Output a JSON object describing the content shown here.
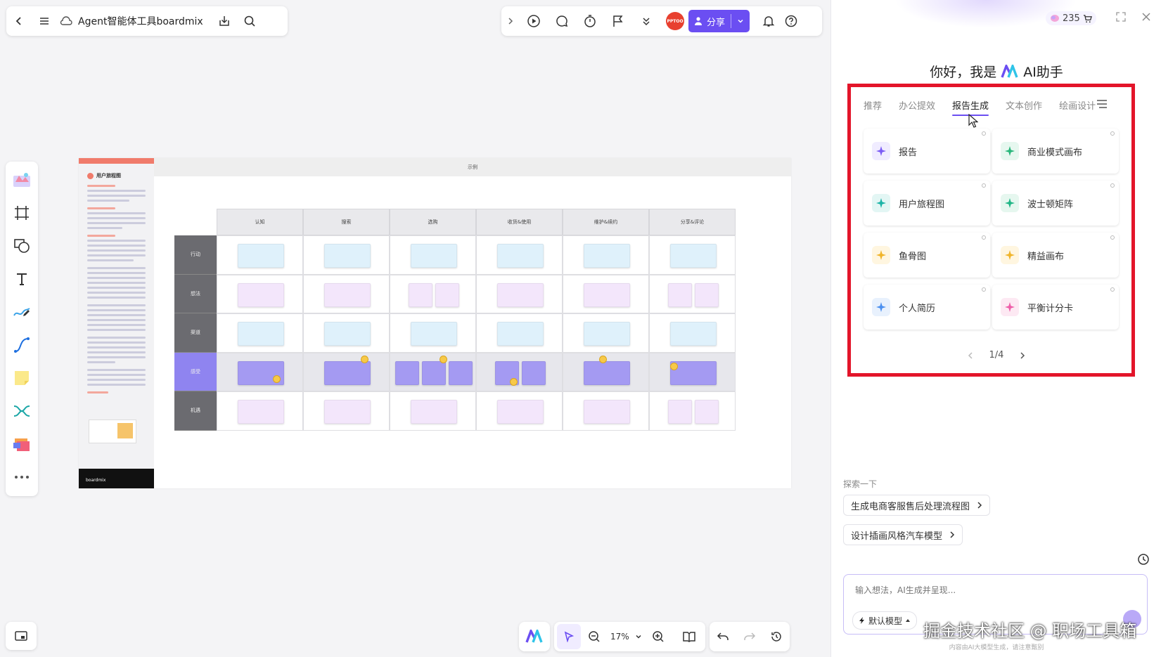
{
  "topbar": {
    "doc_title": "Agent智能体工具boardmix"
  },
  "toolbar": {
    "avatar_text": "PPTOO",
    "share_label": "分享"
  },
  "board": {
    "header_title": "示例",
    "side_title": "用户旅程图",
    "side_footer": "boardmix",
    "columns": [
      "认知",
      "搜索",
      "选购",
      "收货&使用",
      "维护&续约",
      "分享&评论"
    ],
    "rows": [
      "行动",
      "想法",
      "渠道",
      "感受",
      "机遇"
    ]
  },
  "zoom": {
    "value": "17%"
  },
  "ai_panel": {
    "credits": "235",
    "greeting_prefix": "你好，我是",
    "greeting_suffix": "AI助手",
    "tabs": [
      {
        "label": "推荐",
        "active": false
      },
      {
        "label": "办公提效",
        "active": false
      },
      {
        "label": "报告生成",
        "active": true
      },
      {
        "label": "文本创作",
        "active": false
      },
      {
        "label": "绘画设计",
        "active": false
      }
    ],
    "cards": [
      {
        "label": "报告",
        "color": "#7a5af5",
        "bg": "#f0ecff"
      },
      {
        "label": "商业模式画布",
        "color": "#27b67a",
        "bg": "#e6f7ef"
      },
      {
        "label": "用户旅程图",
        "color": "#1ab3a6",
        "bg": "#e3f6f4"
      },
      {
        "label": "波士顿矩阵",
        "color": "#1fb585",
        "bg": "#e6f7ef"
      },
      {
        "label": "鱼骨图",
        "color": "#f0b429",
        "bg": "#fff6e0"
      },
      {
        "label": "精益画布",
        "color": "#f0b429",
        "bg": "#fff6e0"
      },
      {
        "label": "个人简历",
        "color": "#4a8ff0",
        "bg": "#e8f1fd"
      },
      {
        "label": "平衡计分卡",
        "color": "#ee5da8",
        "bg": "#fde9f3"
      }
    ],
    "pager": "1/4",
    "explore_label": "探索一下",
    "suggestions": [
      "生成电商客服售后处理流程图",
      "设计插画风格汽车模型"
    ],
    "chat_placeholder": "输入想法，AI生成并呈现...",
    "model_label": "默认模型",
    "footnote": "内容由AI大模型生成，请注意甄别"
  },
  "watermark": "掘金技术社区 @ 职场工具箱",
  "colors": {
    "accent": "#6b4ef2",
    "highlight_box": "#e3152a"
  }
}
